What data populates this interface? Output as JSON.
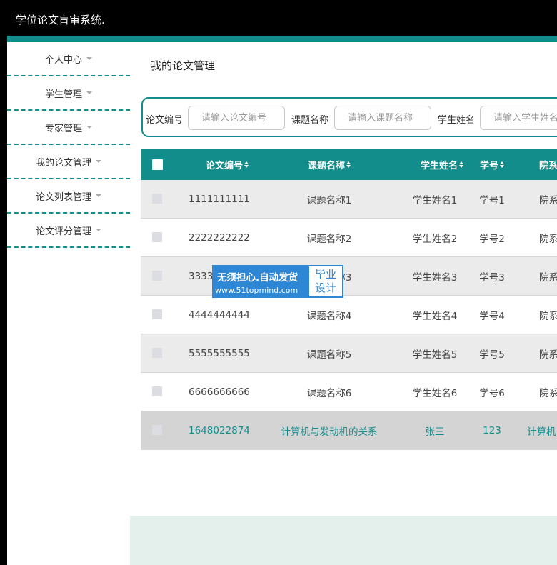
{
  "app": {
    "title": "学位论文盲审系统."
  },
  "sidebar": {
    "items": [
      {
        "label": "个人中心",
        "name": "sidebar-item-personal-center"
      },
      {
        "label": "学生管理",
        "name": "sidebar-item-student-management"
      },
      {
        "label": "专家管理",
        "name": "sidebar-item-expert-management"
      },
      {
        "label": "我的论文管理",
        "name": "sidebar-item-my-thesis-management"
      },
      {
        "label": "论文列表管理",
        "name": "sidebar-item-thesis-list-management"
      },
      {
        "label": "论文评分管理",
        "name": "sidebar-item-thesis-score-management"
      }
    ]
  },
  "main": {
    "title": "我的论文管理",
    "search": {
      "thesis_no_label": "论文编号",
      "thesis_no_placeholder": "请输入论文编号",
      "topic_label": "课题名称",
      "topic_placeholder": "请输入课题名称",
      "student_label": "学生姓名",
      "student_placeholder": "请输入学生姓名"
    },
    "table": {
      "headers": [
        "论文编号",
        "课题名称",
        "学生姓名",
        "学号",
        "院系"
      ],
      "rows": [
        [
          "1111111111",
          "课题名称1",
          "学生姓名1",
          "学号1",
          "院系"
        ],
        [
          "2222222222",
          "课题名称2",
          "学生姓名2",
          "学号2",
          "院系"
        ],
        [
          "3333333333",
          "课题名称3",
          "学生姓名3",
          "学号3",
          "院系"
        ],
        [
          "4444444444",
          "课题名称4",
          "学生姓名4",
          "学号4",
          "院系"
        ],
        [
          "5555555555",
          "课题名称5",
          "学生姓名5",
          "学号5",
          "院系"
        ],
        [
          "6666666666",
          "课题名称6",
          "学生姓名6",
          "学号6",
          "院系"
        ],
        [
          "1648022874",
          "计算机与发动机的关系",
          "张三",
          "123",
          "计算机"
        ]
      ]
    }
  },
  "watermark": {
    "slogan": "无须担心.自动发货",
    "url": "www.51topmind.com",
    "badge_line1": "毕业",
    "badge_line2": "设计"
  },
  "colors": {
    "accent": "#138c8c",
    "watermark": "#2d87d4"
  }
}
